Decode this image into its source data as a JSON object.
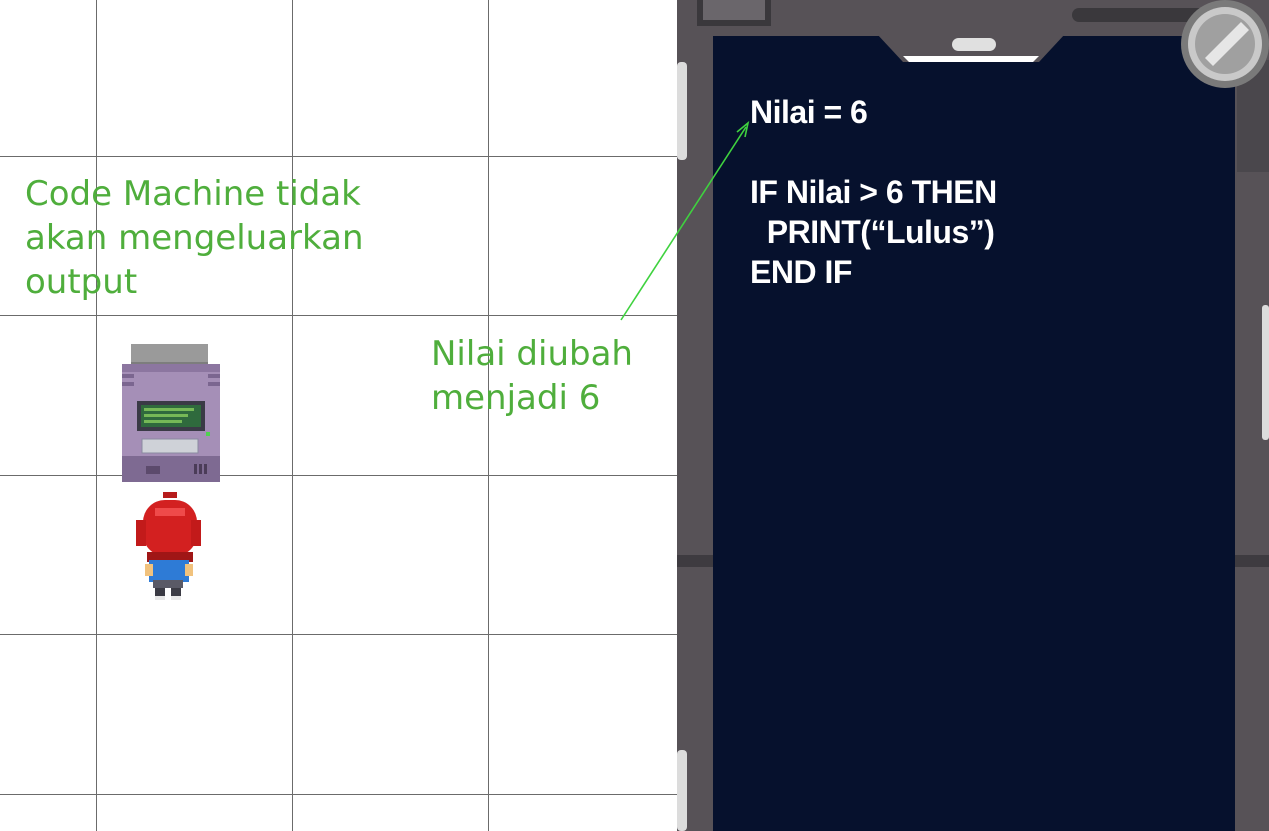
{
  "annotations": {
    "code_machine_note": "Code Machine tidak\nakan mengeluarkan\noutput",
    "value_change_note": "Nilai diubah\nmenjadi 6"
  },
  "code_panel": {
    "lines": [
      "Nilai = 6",
      "",
      "IF Nilai > 6 THEN",
      "  PRINT(“Lulus”)",
      "END IF"
    ]
  },
  "colors": {
    "annotation": "#4fae3c",
    "screen_bg": "#06112d",
    "frame": "#575257"
  },
  "icons": {
    "machine": "code-machine-sprite",
    "player": "player-character-sprite",
    "magnifier": "magnifier-icon"
  }
}
